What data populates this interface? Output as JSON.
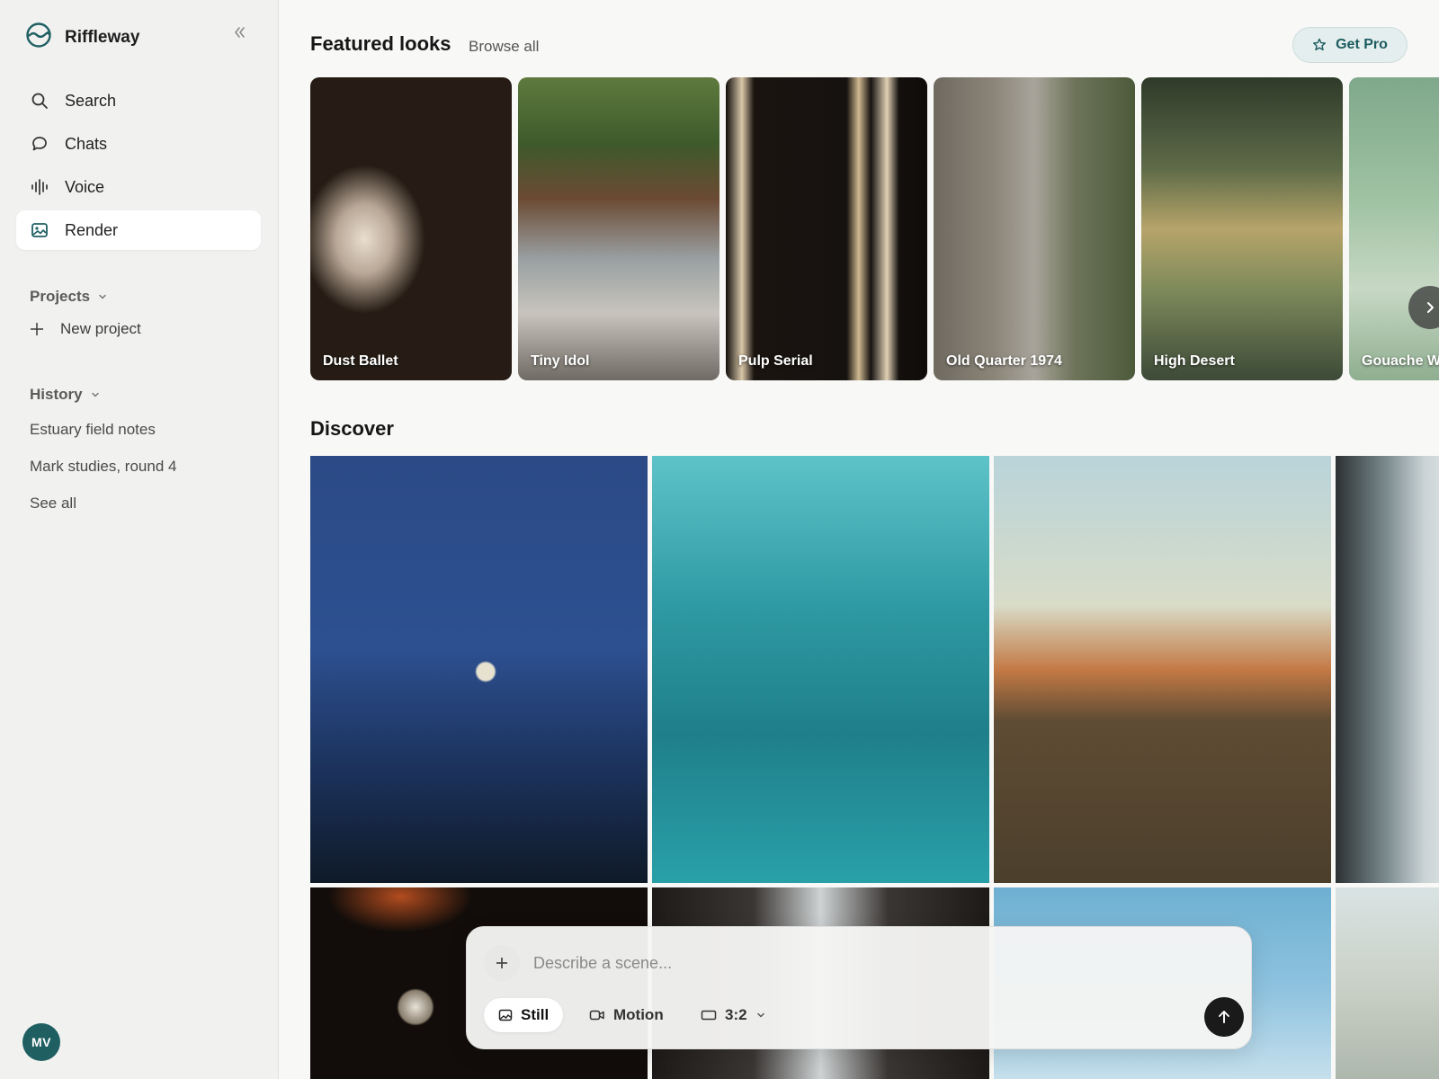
{
  "app": {
    "name": "Riffleway"
  },
  "sidebar": {
    "nav": [
      {
        "label": "Search",
        "icon": "search-icon"
      },
      {
        "label": "Chats",
        "icon": "chat-bubble-icon"
      },
      {
        "label": "Voice",
        "icon": "waveform-icon"
      },
      {
        "label": "Render",
        "icon": "image-icon",
        "active": true
      }
    ],
    "projects": {
      "label": "Projects",
      "new_project": "New project"
    },
    "history": {
      "label": "History",
      "items": [
        "Estuary field notes",
        "Mark studies, round 4"
      ],
      "see_all": "See all"
    },
    "user": {
      "initials": "MV"
    }
  },
  "header": {
    "featured_title": "Featured looks",
    "browse_all": "Browse all",
    "get_pro": "Get Pro"
  },
  "featured": [
    {
      "title": "Dust Ballet"
    },
    {
      "title": "Tiny Idol"
    },
    {
      "title": "Pulp Serial"
    },
    {
      "title": "Old Quarter 1974"
    },
    {
      "title": "High Desert"
    },
    {
      "title": "Gouache W"
    }
  ],
  "discover": {
    "title": "Discover"
  },
  "composer": {
    "placeholder": "Describe a scene...",
    "modes": [
      "Still",
      "Motion"
    ],
    "active_mode": "Still",
    "aspect_ratio": "3:2"
  },
  "colors": {
    "accent": "#1f5f62",
    "pro_bg": "#e4eeee"
  }
}
